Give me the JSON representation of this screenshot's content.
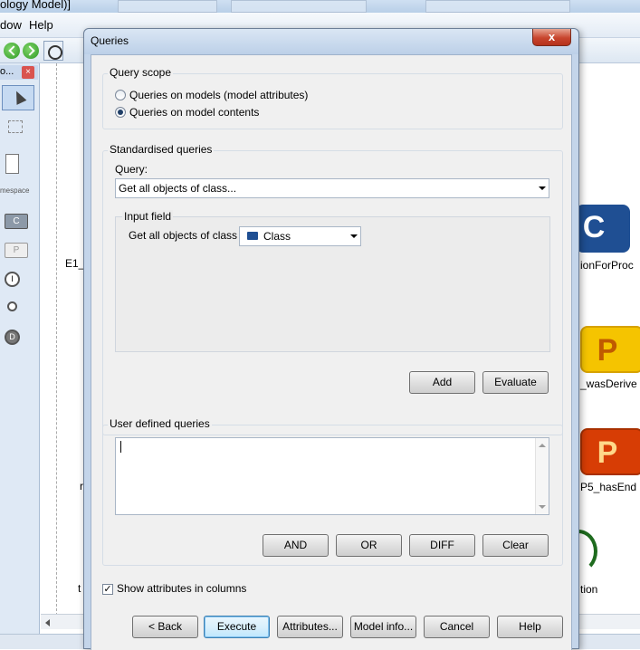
{
  "app": {
    "title_fragment": "ology Model)]",
    "menu": {
      "window_fragment": "dow",
      "help": "Help"
    },
    "palette": {
      "header_fragment": "o...",
      "close_glyph": "×",
      "namespace_fragment": "mespace",
      "tools": {
        "c": "C",
        "p": "P",
        "i": "I",
        "d": "D"
      }
    },
    "canvas": {
      "texts": {
        "e1": "E1_",
        "ion_for_proc": "ionForProc",
        "was_derive": "_wasDerive",
        "p5_has_end": "P5_hasEnd",
        "tion": "tion",
        "r_frag": "r",
        "t_frag": "t"
      },
      "nodes": {
        "c": "C",
        "p1": "P",
        "p2": "P"
      }
    }
  },
  "dialog": {
    "title": "Queries",
    "close_glyph": "x",
    "query_scope": {
      "title": "Query scope",
      "options": [
        {
          "label": "Queries on models (model attributes)",
          "selected": false
        },
        {
          "label": "Queries on model contents",
          "selected": true
        }
      ]
    },
    "standardised": {
      "title": "Standardised queries",
      "query_label": "Query:",
      "query_value": "Get all objects of class...",
      "input_field": {
        "title": "Input field",
        "label": "Get all objects of class",
        "class_icon": "class-icon",
        "value": "Class"
      },
      "add_label": "Add",
      "evaluate_label": "Evaluate"
    },
    "user_defined": {
      "title": "User defined queries",
      "text": "",
      "buttons": {
        "and": "AND",
        "or": "OR",
        "diff": "DIFF",
        "clear": "Clear"
      }
    },
    "show_attributes": {
      "label": "Show attributes in columns",
      "checked": true,
      "mark": "✓"
    },
    "footer": {
      "back": "< Back",
      "execute": "Execute",
      "attributes": "Attributes...",
      "model_info": "Model info...",
      "cancel": "Cancel",
      "help": "Help"
    }
  }
}
